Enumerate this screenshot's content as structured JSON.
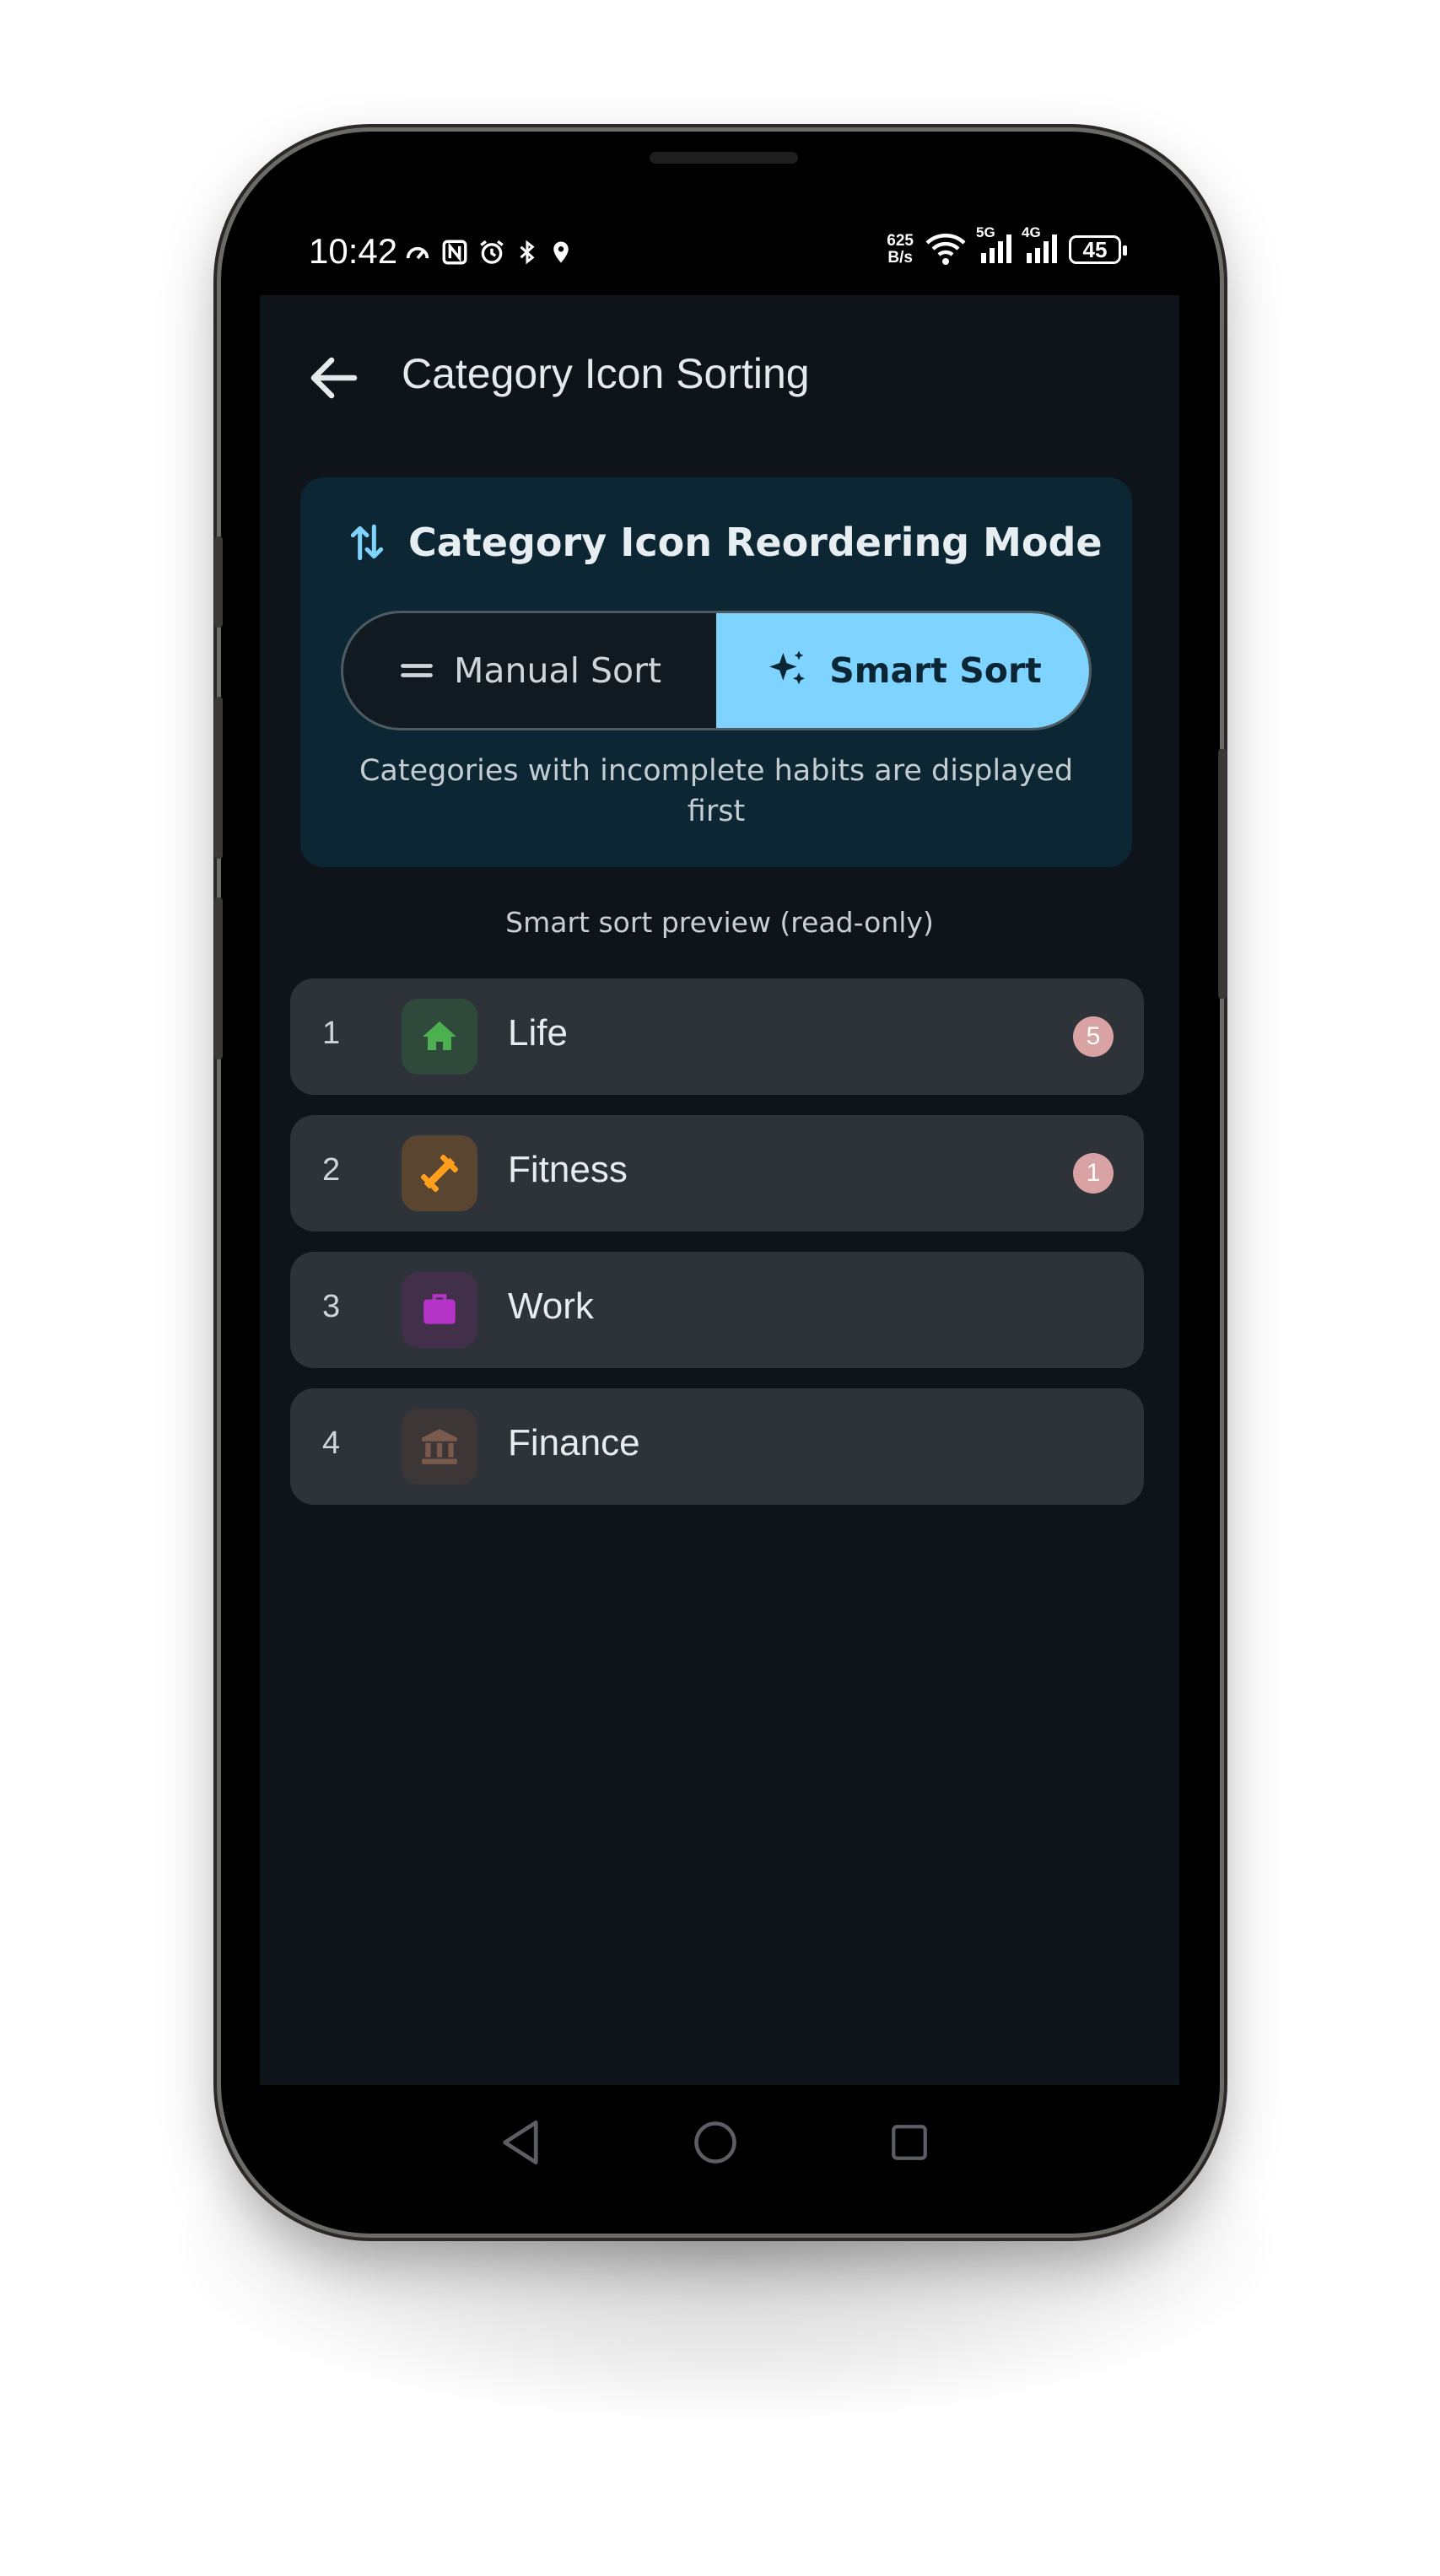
{
  "status_bar": {
    "time": "10:42",
    "net_speed_value": "625",
    "net_speed_unit": "B/s",
    "signal_1": "5G",
    "signal_2": "4G",
    "battery": "45",
    "left_icons": [
      "speed-meter-icon",
      "nfc-icon",
      "alarm-icon",
      "bluetooth-icon",
      "location-icon"
    ],
    "right_icons": [
      "wifi-icon",
      "signal-bars-icon",
      "signal-bars-icon",
      "battery-icon"
    ]
  },
  "app_bar": {
    "title": "Category Icon Sorting",
    "back_icon": "arrow-left-icon"
  },
  "mode_card": {
    "title": "Category Icon Reordering Mode",
    "title_icon": "sort-arrows-icon",
    "options": [
      {
        "label": "Manual Sort",
        "icon": "drag-handle-icon",
        "selected": false
      },
      {
        "label": "Smart Sort",
        "icon": "sparkle-icon",
        "selected": true
      }
    ],
    "description": "Categories with incomplete habits are displayed first"
  },
  "preview": {
    "label": "Smart sort preview (read-only)",
    "items": [
      {
        "rank": "1",
        "label": "Life",
        "icon": "home-icon",
        "icon_color": "#4caf50",
        "icon_bg": "#2f4a3a",
        "badge": "5"
      },
      {
        "rank": "2",
        "label": "Fitness",
        "icon": "dumbbell-icon",
        "icon_color": "#ff9f1c",
        "icon_bg": "#5a4530",
        "badge": "1"
      },
      {
        "rank": "3",
        "label": "Work",
        "icon": "briefcase-icon",
        "icon_color": "#b534c8",
        "icon_bg": "#42304a",
        "badge": ""
      },
      {
        "rank": "4",
        "label": "Finance",
        "icon": "bank-icon",
        "icon_color": "#7b5a4e",
        "icon_bg": "#3d3636",
        "badge": ""
      }
    ]
  },
  "colors": {
    "accent": "#7fd3ff",
    "screen_bg": "#0f141a",
    "card_bg": "#0c2633",
    "row_bg": "#2e3339",
    "badge_bg": "#d9a3a3"
  },
  "nav_bar": {
    "back": "triangle-back-icon",
    "home": "circle-home-icon",
    "recents": "square-recents-icon"
  }
}
